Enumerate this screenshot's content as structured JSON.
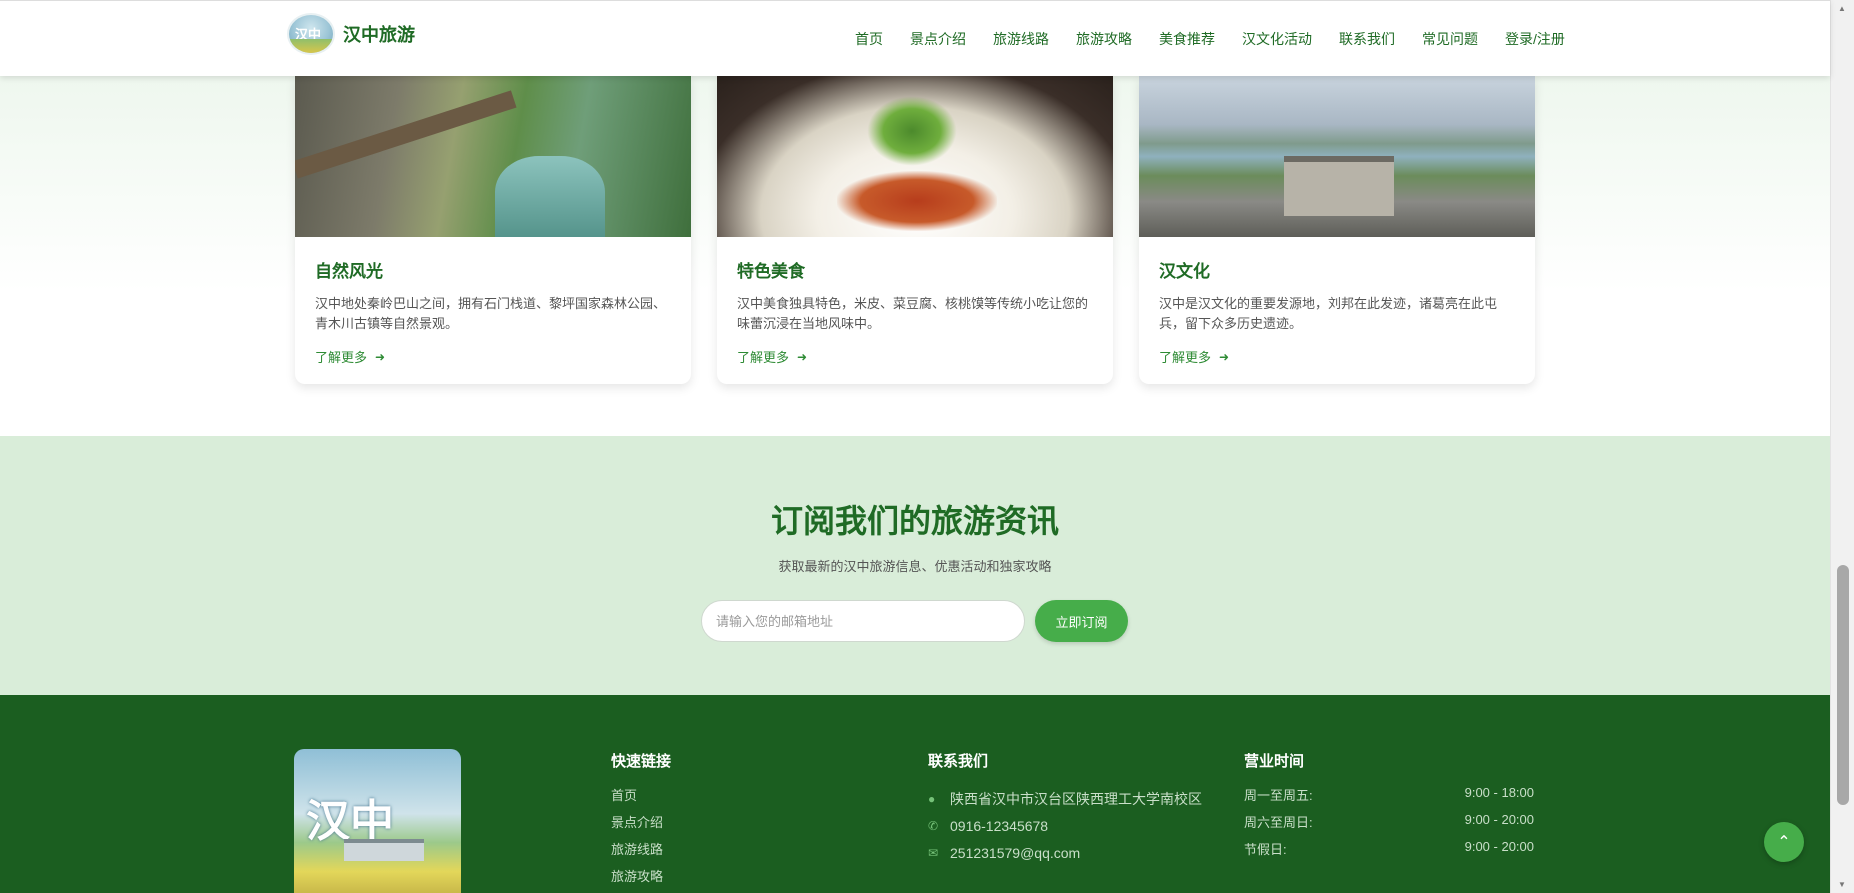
{
  "header": {
    "logo_text": "汉中",
    "site_title": "汉中旅游",
    "nav": [
      "首页",
      "景点介绍",
      "旅游线路",
      "旅游攻略",
      "美食推荐",
      "汉文化活动",
      "联系我们",
      "常见问题",
      "登录/注册"
    ]
  },
  "cards": [
    {
      "title": "自然风光",
      "desc": "汉中地处秦岭巴山之间，拥有石门栈道、黎坪国家森林公园、青木川古镇等自然景观。",
      "more": "了解更多"
    },
    {
      "title": "特色美食",
      "desc": "汉中美食独具特色，米皮、菜豆腐、核桃馍等传统小吃让您的味蕾沉浸在当地风味中。",
      "more": "了解更多"
    },
    {
      "title": "汉文化",
      "desc": "汉中是汉文化的重要发源地，刘邦在此发迹，诸葛亮在此屯兵，留下众多历史遗迹。",
      "more": "了解更多"
    }
  ],
  "subscribe": {
    "title": "订阅我们的旅游资讯",
    "desc": "获取最新的汉中旅游信息、优惠活动和独家攻略",
    "placeholder": "请输入您的邮箱地址",
    "button": "立即订阅"
  },
  "footer": {
    "logo_text": "汉中",
    "quick_links_title": "快速链接",
    "quick_links": [
      "首页",
      "景点介绍",
      "旅游线路",
      "旅游攻略"
    ],
    "contact_title": "联系我们",
    "contact": {
      "address": "陕西省汉中市汉台区陕西理工大学南校区",
      "phone": "0916-12345678",
      "email": "251231579@qq.com"
    },
    "hours_title": "营业时间",
    "hours": [
      {
        "label": "周一至周五:",
        "time": "9:00 - 18:00"
      },
      {
        "label": "周六至周日:",
        "time": "9:00 - 20:00"
      },
      {
        "label": "节假日:",
        "time": "9:00 - 20:00"
      }
    ]
  },
  "icons": {
    "arrow": "arrow-right-icon",
    "location": "map-marker-icon",
    "phone": "phone-icon",
    "email": "envelope-icon",
    "back_to_top": "chevron-up-icon"
  },
  "colors": {
    "brand_green": "#1f6b25",
    "accent_green": "#46ad4a",
    "footer_bg": "#1b5e20",
    "subscribe_bg": "#d9edd9"
  }
}
